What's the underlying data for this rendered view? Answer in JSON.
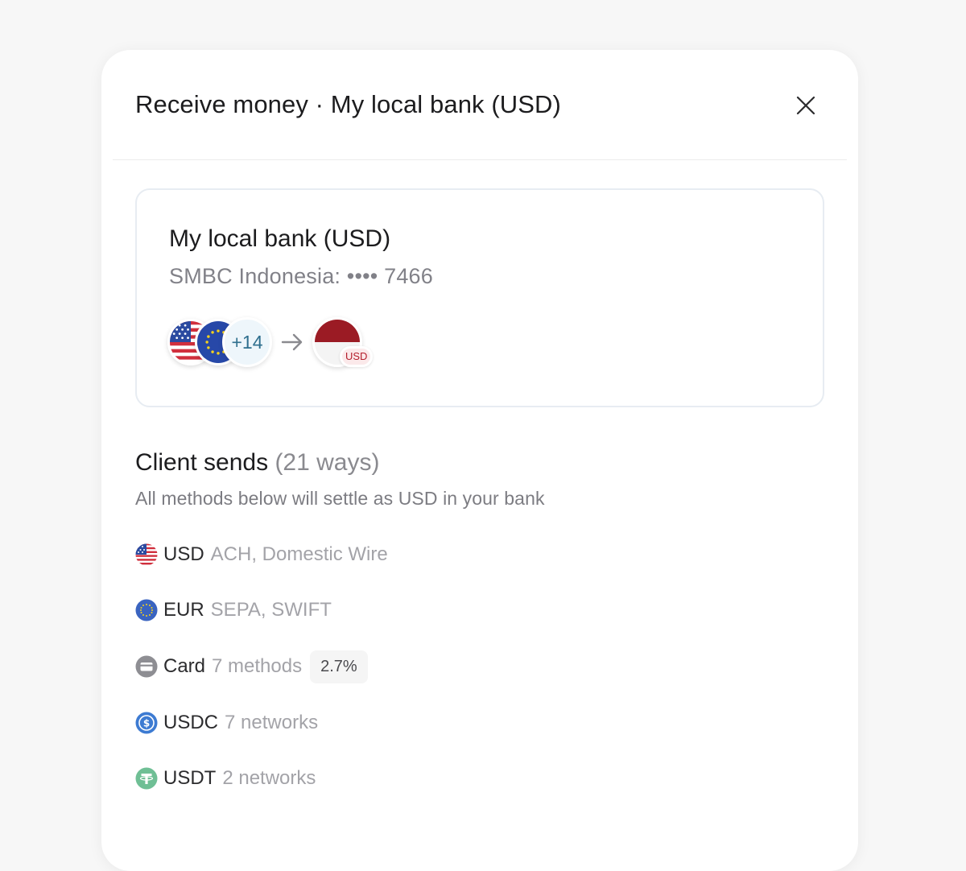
{
  "modal": {
    "title": "Receive money · My local bank (USD)",
    "close_icon": "close-icon"
  },
  "account": {
    "name": "My local bank (USD)",
    "subtitle": "SMBC Indonesia: •••• 7466",
    "source_flags": [
      "us-flag-icon",
      "eu-flag-icon"
    ],
    "more_count": "+14",
    "destination_flag": "indonesia-flag-icon",
    "destination_currency": "USD"
  },
  "section": {
    "title": "Client sends",
    "count": "(21 ways)",
    "subtitle": "All methods below will settle as USD in your bank"
  },
  "methods": [
    {
      "icon": "us-flag-icon",
      "name": "USD",
      "detail": "ACH, Domestic Wire"
    },
    {
      "icon": "eu-flag-icon",
      "name": "EUR",
      "detail": "SEPA, SWIFT"
    },
    {
      "icon": "card-icon",
      "name": "Card",
      "detail": "7 methods",
      "fee": "2.7%"
    },
    {
      "icon": "usdc-icon",
      "name": "USDC",
      "detail": "7 networks"
    },
    {
      "icon": "usdt-icon",
      "name": "USDT",
      "detail": "2 networks"
    }
  ],
  "colors": {
    "usd_chip_text": "#b41e2c",
    "usdc_blue": "#3d7bd2",
    "usdt_green": "#6fbf95",
    "eur_blue": "#3a64c0"
  }
}
